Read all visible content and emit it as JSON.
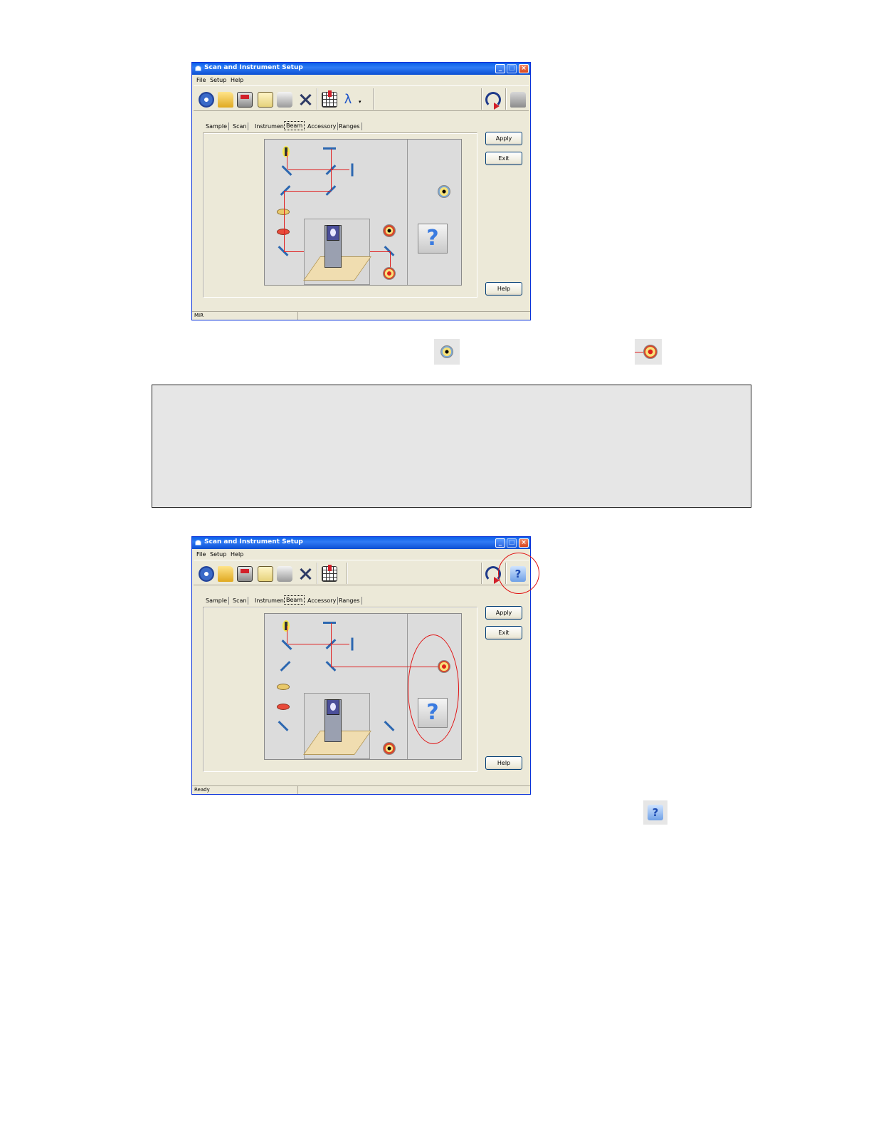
{
  "window_title": "Scan and Instrument Setup",
  "menu": [
    "File",
    "Setup",
    "Help"
  ],
  "tabs": [
    "Sample",
    "Scan",
    "Instrument",
    "Beam",
    "Accessory",
    "Ranges"
  ],
  "active_tab": "Beam",
  "buttons": {
    "apply": "Apply",
    "exit": "Exit",
    "help": "Help"
  },
  "window1": {
    "status": "MIR"
  },
  "window2": {
    "status": "Ready"
  },
  "toolbar_icons": [
    "instrument-gauge-icon",
    "open-folder-icon",
    "save-icon",
    "clipboard-icon",
    "print-icon",
    "tools-icon",
    "table-icon",
    "lambda-icon",
    "scan-arc-icon",
    "accessory-icon"
  ],
  "colors": {
    "beam": "#e02020",
    "highlight": "#e01010",
    "titlebar": "#0a5fe8"
  }
}
